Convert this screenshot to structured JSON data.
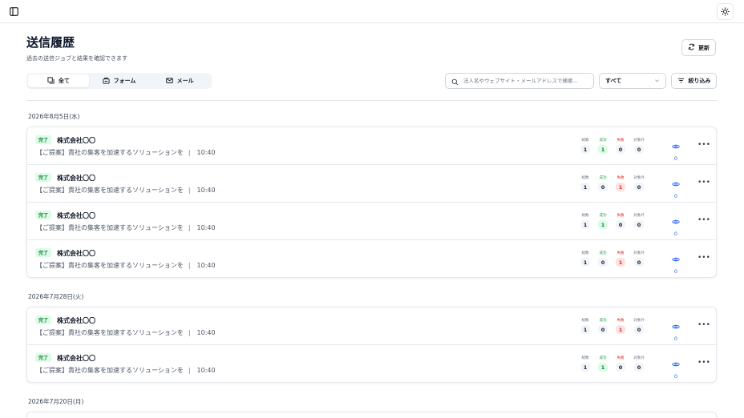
{
  "header": {
    "title": "送信履歴",
    "subtitle": "過去の送信ジョブと結果を確認できます",
    "refresh_label": "更新"
  },
  "tabs": [
    {
      "label": "全て",
      "icon": "all-icon",
      "active": true
    },
    {
      "label": "フォーム",
      "icon": "form-icon",
      "active": false
    },
    {
      "label": "メール",
      "icon": "mail-icon",
      "active": false
    }
  ],
  "search": {
    "placeholder": "法人名やウェブサイト・メールアドレスで検索..."
  },
  "filter_select": {
    "value": "すべて"
  },
  "filter_button_label": "絞り込み",
  "stat_labels": {
    "total": "総数",
    "success": "成功",
    "fail": "失敗",
    "excluded": "対象外"
  },
  "groups": [
    {
      "date": "2026年8月5日(水)",
      "rows": [
        {
          "status": "完了",
          "company": "株式会社〇〇",
          "subject": "【ご提案】貴社の集客を加速するソリューションを",
          "sep": "|",
          "time": "10:40",
          "total": "1",
          "success": "1",
          "fail": "0",
          "excluded": "0",
          "views": "0"
        },
        {
          "status": "完了",
          "company": "株式会社〇〇",
          "subject": "【ご提案】貴社の集客を加速するソリューションを",
          "sep": "|",
          "time": "10:40",
          "total": "1",
          "success": "0",
          "fail": "1",
          "excluded": "0",
          "views": "0"
        },
        {
          "status": "完了",
          "company": "株式会社〇〇",
          "subject": "【ご提案】貴社の集客を加速するソリューションを",
          "sep": "|",
          "time": "10:40",
          "total": "1",
          "success": "1",
          "fail": "0",
          "excluded": "0",
          "views": "0"
        },
        {
          "status": "完了",
          "company": "株式会社〇〇",
          "subject": "【ご提案】貴社の集客を加速するソリューションを",
          "sep": "|",
          "time": "10:40",
          "total": "1",
          "success": "0",
          "fail": "1",
          "excluded": "0",
          "views": "0"
        }
      ]
    },
    {
      "date": "2026年7月28日(火)",
      "rows": [
        {
          "status": "完了",
          "company": "株式会社〇〇",
          "subject": "【ご提案】貴社の集客を加速するソリューションを",
          "sep": "|",
          "time": "10:40",
          "total": "1",
          "success": "0",
          "fail": "1",
          "excluded": "0",
          "views": "0"
        },
        {
          "status": "完了",
          "company": "株式会社〇〇",
          "subject": "【ご提案】貴社の集客を加速するソリューションを",
          "sep": "|",
          "time": "10:40",
          "total": "1",
          "success": "1",
          "fail": "0",
          "excluded": "0",
          "views": "0"
        }
      ]
    },
    {
      "date": "2026年7月20日(月)",
      "rows": []
    }
  ],
  "colors": {
    "success": "#15803d",
    "fail": "#dc2626",
    "accent": "#2563eb"
  }
}
